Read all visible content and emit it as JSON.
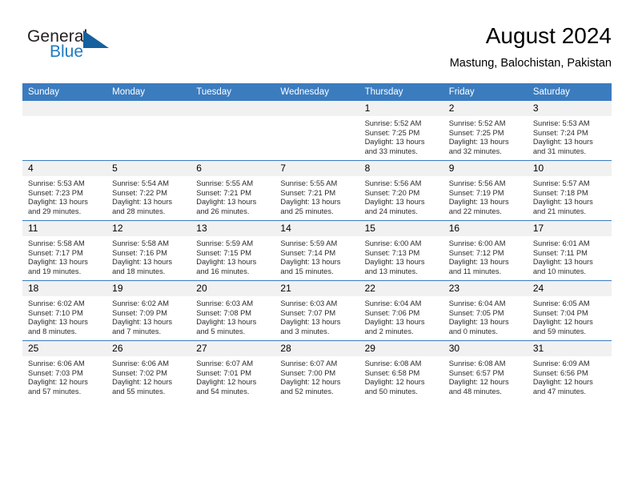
{
  "brand": {
    "name_part1": "General",
    "name_part2": "Blue",
    "logo_icon": "blue-triangle-logo"
  },
  "header": {
    "month_title": "August 2024",
    "location": "Mastung, Balochistan, Pakistan"
  },
  "theme": {
    "header_blue": "#3b7cbf",
    "brand_blue": "#1f7bc1",
    "logo_blue": "#15609e",
    "daynum_background": "#f1f1f1"
  },
  "calendar": {
    "weekday_headers": [
      "Sunday",
      "Monday",
      "Tuesday",
      "Wednesday",
      "Thursday",
      "Friday",
      "Saturday"
    ],
    "labels": {
      "sunrise": "Sunrise:",
      "sunset": "Sunset:",
      "daylight": "Daylight:"
    },
    "weeks": [
      [
        {
          "day": "",
          "blank": true,
          "sunrise": "",
          "sunset": "",
          "daylight_line1": "",
          "daylight_line2": ""
        },
        {
          "day": "",
          "blank": true,
          "sunrise": "",
          "sunset": "",
          "daylight_line1": "",
          "daylight_line2": ""
        },
        {
          "day": "",
          "blank": true,
          "sunrise": "",
          "sunset": "",
          "daylight_line1": "",
          "daylight_line2": ""
        },
        {
          "day": "",
          "blank": true,
          "sunrise": "",
          "sunset": "",
          "daylight_line1": "",
          "daylight_line2": ""
        },
        {
          "day": "1",
          "blank": false,
          "sunrise": "Sunrise: 5:52 AM",
          "sunset": "Sunset: 7:25 PM",
          "daylight_line1": "Daylight: 13 hours",
          "daylight_line2": "and 33 minutes."
        },
        {
          "day": "2",
          "blank": false,
          "sunrise": "Sunrise: 5:52 AM",
          "sunset": "Sunset: 7:25 PM",
          "daylight_line1": "Daylight: 13 hours",
          "daylight_line2": "and 32 minutes."
        },
        {
          "day": "3",
          "blank": false,
          "sunrise": "Sunrise: 5:53 AM",
          "sunset": "Sunset: 7:24 PM",
          "daylight_line1": "Daylight: 13 hours",
          "daylight_line2": "and 31 minutes."
        }
      ],
      [
        {
          "day": "4",
          "blank": false,
          "sunrise": "Sunrise: 5:53 AM",
          "sunset": "Sunset: 7:23 PM",
          "daylight_line1": "Daylight: 13 hours",
          "daylight_line2": "and 29 minutes."
        },
        {
          "day": "5",
          "blank": false,
          "sunrise": "Sunrise: 5:54 AM",
          "sunset": "Sunset: 7:22 PM",
          "daylight_line1": "Daylight: 13 hours",
          "daylight_line2": "and 28 minutes."
        },
        {
          "day": "6",
          "blank": false,
          "sunrise": "Sunrise: 5:55 AM",
          "sunset": "Sunset: 7:21 PM",
          "daylight_line1": "Daylight: 13 hours",
          "daylight_line2": "and 26 minutes."
        },
        {
          "day": "7",
          "blank": false,
          "sunrise": "Sunrise: 5:55 AM",
          "sunset": "Sunset: 7:21 PM",
          "daylight_line1": "Daylight: 13 hours",
          "daylight_line2": "and 25 minutes."
        },
        {
          "day": "8",
          "blank": false,
          "sunrise": "Sunrise: 5:56 AM",
          "sunset": "Sunset: 7:20 PM",
          "daylight_line1": "Daylight: 13 hours",
          "daylight_line2": "and 24 minutes."
        },
        {
          "day": "9",
          "blank": false,
          "sunrise": "Sunrise: 5:56 AM",
          "sunset": "Sunset: 7:19 PM",
          "daylight_line1": "Daylight: 13 hours",
          "daylight_line2": "and 22 minutes."
        },
        {
          "day": "10",
          "blank": false,
          "sunrise": "Sunrise: 5:57 AM",
          "sunset": "Sunset: 7:18 PM",
          "daylight_line1": "Daylight: 13 hours",
          "daylight_line2": "and 21 minutes."
        }
      ],
      [
        {
          "day": "11",
          "blank": false,
          "sunrise": "Sunrise: 5:58 AM",
          "sunset": "Sunset: 7:17 PM",
          "daylight_line1": "Daylight: 13 hours",
          "daylight_line2": "and 19 minutes."
        },
        {
          "day": "12",
          "blank": false,
          "sunrise": "Sunrise: 5:58 AM",
          "sunset": "Sunset: 7:16 PM",
          "daylight_line1": "Daylight: 13 hours",
          "daylight_line2": "and 18 minutes."
        },
        {
          "day": "13",
          "blank": false,
          "sunrise": "Sunrise: 5:59 AM",
          "sunset": "Sunset: 7:15 PM",
          "daylight_line1": "Daylight: 13 hours",
          "daylight_line2": "and 16 minutes."
        },
        {
          "day": "14",
          "blank": false,
          "sunrise": "Sunrise: 5:59 AM",
          "sunset": "Sunset: 7:14 PM",
          "daylight_line1": "Daylight: 13 hours",
          "daylight_line2": "and 15 minutes."
        },
        {
          "day": "15",
          "blank": false,
          "sunrise": "Sunrise: 6:00 AM",
          "sunset": "Sunset: 7:13 PM",
          "daylight_line1": "Daylight: 13 hours",
          "daylight_line2": "and 13 minutes."
        },
        {
          "day": "16",
          "blank": false,
          "sunrise": "Sunrise: 6:00 AM",
          "sunset": "Sunset: 7:12 PM",
          "daylight_line1": "Daylight: 13 hours",
          "daylight_line2": "and 11 minutes."
        },
        {
          "day": "17",
          "blank": false,
          "sunrise": "Sunrise: 6:01 AM",
          "sunset": "Sunset: 7:11 PM",
          "daylight_line1": "Daylight: 13 hours",
          "daylight_line2": "and 10 minutes."
        }
      ],
      [
        {
          "day": "18",
          "blank": false,
          "sunrise": "Sunrise: 6:02 AM",
          "sunset": "Sunset: 7:10 PM",
          "daylight_line1": "Daylight: 13 hours",
          "daylight_line2": "and 8 minutes."
        },
        {
          "day": "19",
          "blank": false,
          "sunrise": "Sunrise: 6:02 AM",
          "sunset": "Sunset: 7:09 PM",
          "daylight_line1": "Daylight: 13 hours",
          "daylight_line2": "and 7 minutes."
        },
        {
          "day": "20",
          "blank": false,
          "sunrise": "Sunrise: 6:03 AM",
          "sunset": "Sunset: 7:08 PM",
          "daylight_line1": "Daylight: 13 hours",
          "daylight_line2": "and 5 minutes."
        },
        {
          "day": "21",
          "blank": false,
          "sunrise": "Sunrise: 6:03 AM",
          "sunset": "Sunset: 7:07 PM",
          "daylight_line1": "Daylight: 13 hours",
          "daylight_line2": "and 3 minutes."
        },
        {
          "day": "22",
          "blank": false,
          "sunrise": "Sunrise: 6:04 AM",
          "sunset": "Sunset: 7:06 PM",
          "daylight_line1": "Daylight: 13 hours",
          "daylight_line2": "and 2 minutes."
        },
        {
          "day": "23",
          "blank": false,
          "sunrise": "Sunrise: 6:04 AM",
          "sunset": "Sunset: 7:05 PM",
          "daylight_line1": "Daylight: 13 hours",
          "daylight_line2": "and 0 minutes."
        },
        {
          "day": "24",
          "blank": false,
          "sunrise": "Sunrise: 6:05 AM",
          "sunset": "Sunset: 7:04 PM",
          "daylight_line1": "Daylight: 12 hours",
          "daylight_line2": "and 59 minutes."
        }
      ],
      [
        {
          "day": "25",
          "blank": false,
          "sunrise": "Sunrise: 6:06 AM",
          "sunset": "Sunset: 7:03 PM",
          "daylight_line1": "Daylight: 12 hours",
          "daylight_line2": "and 57 minutes."
        },
        {
          "day": "26",
          "blank": false,
          "sunrise": "Sunrise: 6:06 AM",
          "sunset": "Sunset: 7:02 PM",
          "daylight_line1": "Daylight: 12 hours",
          "daylight_line2": "and 55 minutes."
        },
        {
          "day": "27",
          "blank": false,
          "sunrise": "Sunrise: 6:07 AM",
          "sunset": "Sunset: 7:01 PM",
          "daylight_line1": "Daylight: 12 hours",
          "daylight_line2": "and 54 minutes."
        },
        {
          "day": "28",
          "blank": false,
          "sunrise": "Sunrise: 6:07 AM",
          "sunset": "Sunset: 7:00 PM",
          "daylight_line1": "Daylight: 12 hours",
          "daylight_line2": "and 52 minutes."
        },
        {
          "day": "29",
          "blank": false,
          "sunrise": "Sunrise: 6:08 AM",
          "sunset": "Sunset: 6:58 PM",
          "daylight_line1": "Daylight: 12 hours",
          "daylight_line2": "and 50 minutes."
        },
        {
          "day": "30",
          "blank": false,
          "sunrise": "Sunrise: 6:08 AM",
          "sunset": "Sunset: 6:57 PM",
          "daylight_line1": "Daylight: 12 hours",
          "daylight_line2": "and 48 minutes."
        },
        {
          "day": "31",
          "blank": false,
          "sunrise": "Sunrise: 6:09 AM",
          "sunset": "Sunset: 6:56 PM",
          "daylight_line1": "Daylight: 12 hours",
          "daylight_line2": "and 47 minutes."
        }
      ]
    ]
  }
}
